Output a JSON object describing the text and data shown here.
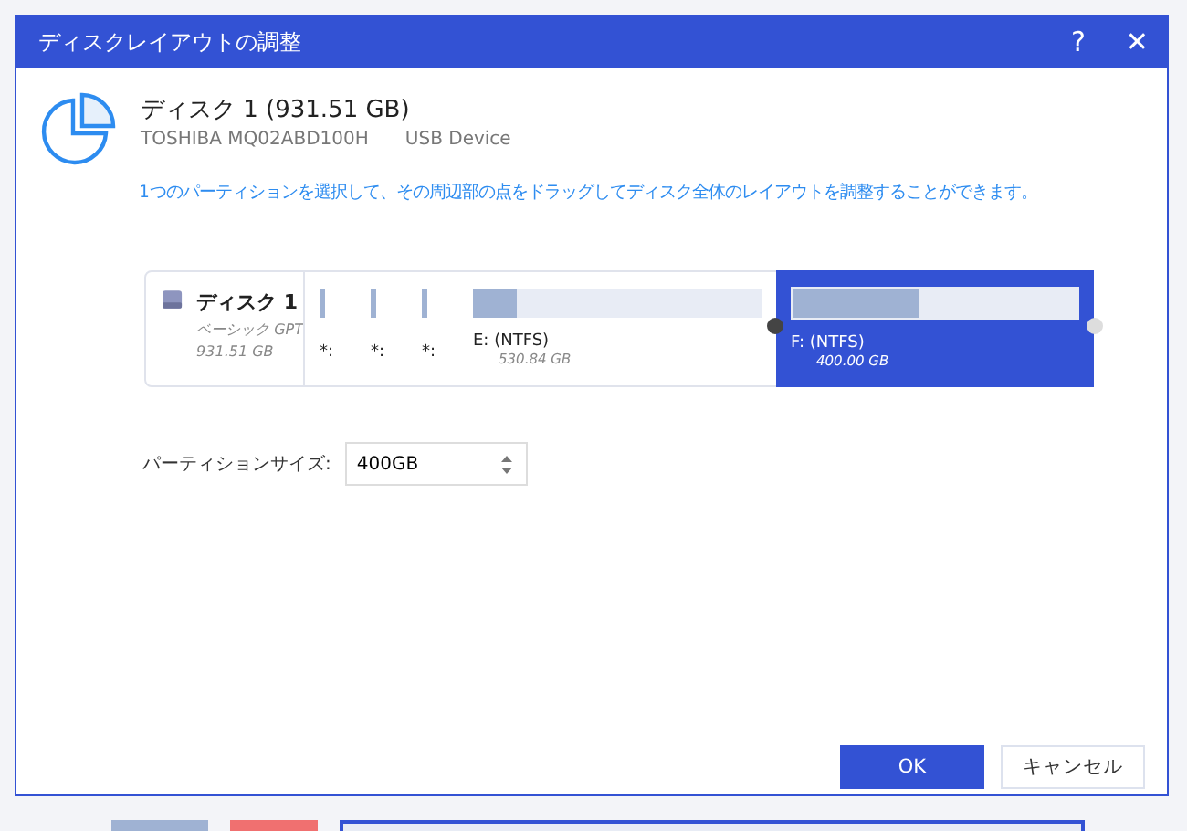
{
  "window": {
    "title": "ディスクレイアウトの調整",
    "help": "?",
    "close": "✕"
  },
  "disk": {
    "title": "ディスク 1 (931.51 GB)",
    "model": "TOSHIBA  MQ02ABD100H",
    "interface": "USB Device"
  },
  "instruction": "1つのパーティションを選択して、その周辺部の点をドラッグしてディスク全体のレイアウトを調整することができます。",
  "disk_map": {
    "name": "ディスク 1",
    "type": "ベーシック GPT",
    "size": "931.51 GB",
    "partitions": [
      {
        "kind": "small",
        "label": "*:",
        "level": 1
      },
      {
        "kind": "small",
        "label": "*:",
        "level": 1
      },
      {
        "kind": "small",
        "label": "*:",
        "level": 1
      },
      {
        "kind": "main",
        "label": "E: (NTFS)",
        "size": "530.84 GB",
        "level": 0.15,
        "selected": false
      },
      {
        "kind": "main",
        "label": "F: (NTFS)",
        "size": "400.00 GB",
        "level": 0.44,
        "selected": true
      }
    ]
  },
  "partition_size": {
    "label": "パーティションサイズ:",
    "value": "400GB"
  },
  "buttons": [
    {
      "label": "OK",
      "kind": "primary"
    },
    {
      "label": "キャンセル",
      "kind": "secondary"
    }
  ]
}
